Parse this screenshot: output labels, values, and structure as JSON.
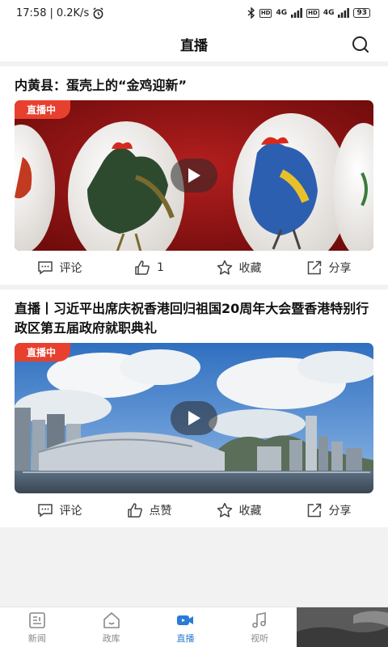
{
  "status_bar": {
    "time": "17:58",
    "net_speed": "0.2K/s",
    "hd1": "HD",
    "net1": "4G",
    "hd2": "HD",
    "net2": "4G",
    "battery": "93"
  },
  "header": {
    "title": "直播",
    "search_icon": "search-icon"
  },
  "feed": [
    {
      "title": "内黄县：蛋壳上的“金鸡迎新”",
      "badge": "直播中",
      "actions": {
        "comment": "评论",
        "like": "1",
        "favorite": "收藏",
        "share": "分享"
      }
    },
    {
      "title": "直播丨习近平出席庆祝香港回归祖国20周年大会暨香港特别行政区第五届政府就职典礼",
      "badge": "直播中",
      "actions": {
        "comment": "评论",
        "like": "点赞",
        "favorite": "收藏",
        "share": "分享"
      }
    }
  ],
  "tabs": [
    {
      "label": "新闻",
      "icon": "news-icon"
    },
    {
      "label": "政库",
      "icon": "home-icon"
    },
    {
      "label": "直播",
      "icon": "live-camera-icon",
      "active": true
    },
    {
      "label": "视听",
      "icon": "music-icon"
    }
  ],
  "colors": {
    "accent": "#2a7bd5",
    "badge": "#e8402f"
  }
}
